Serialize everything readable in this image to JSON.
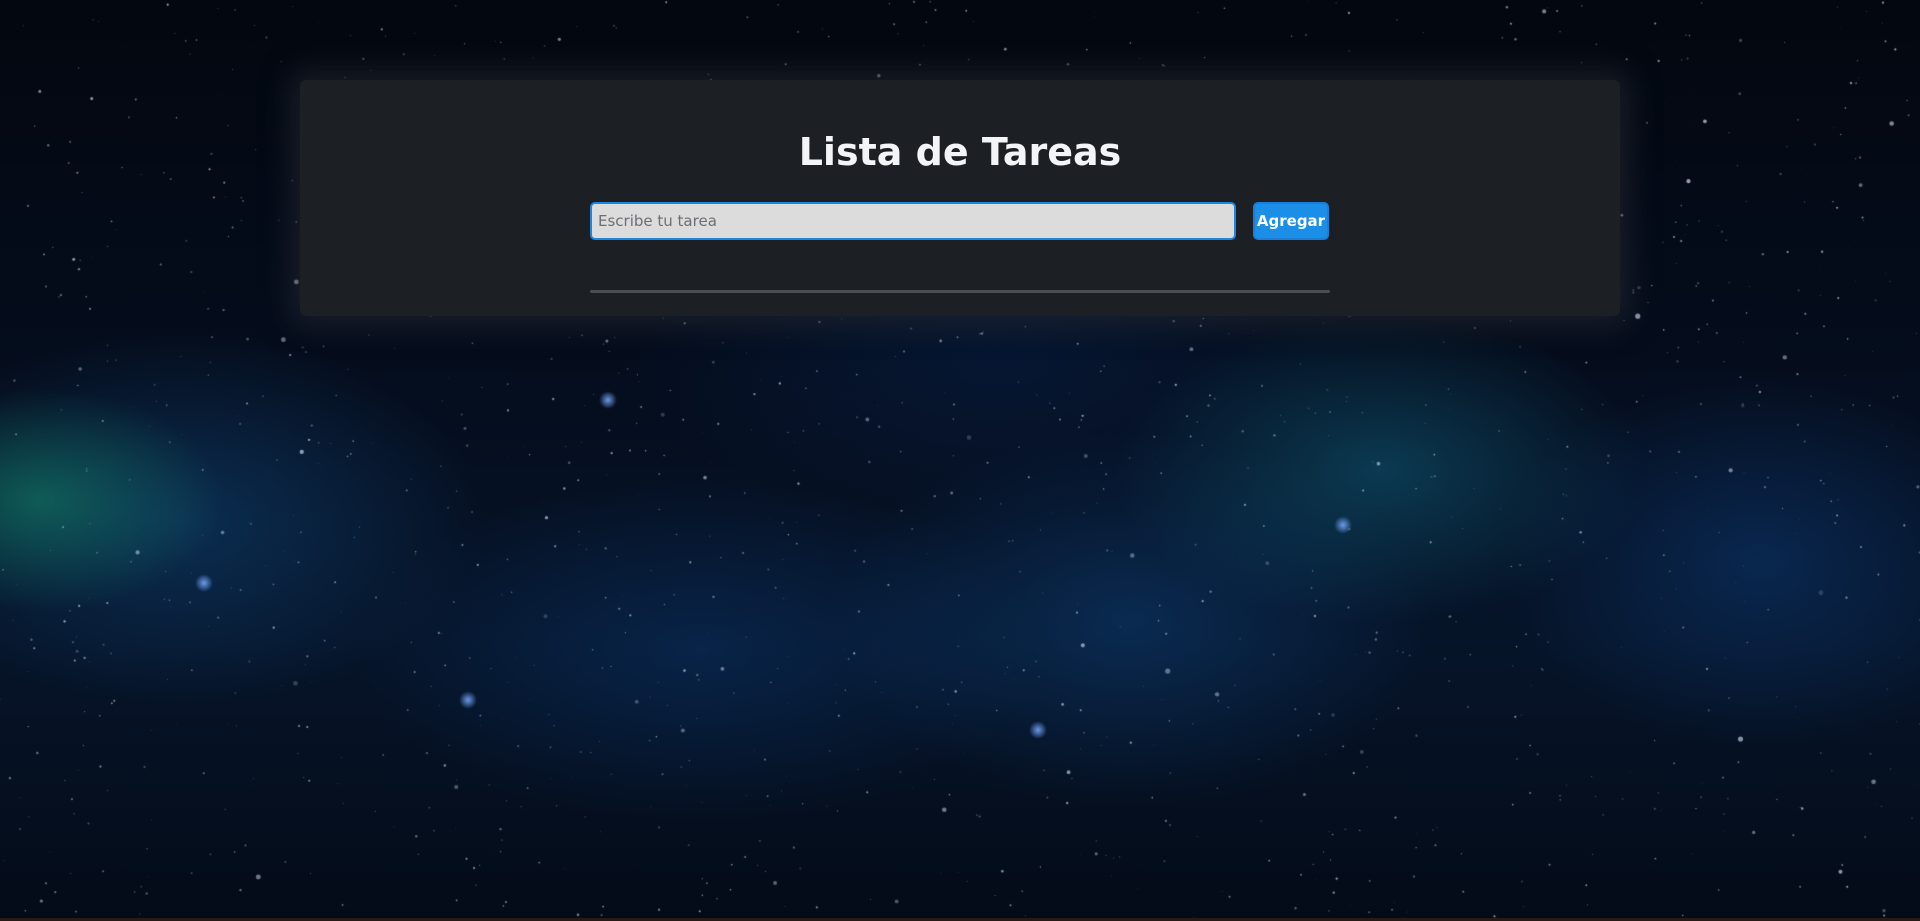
{
  "app": {
    "title": "Lista de Tareas"
  },
  "task_form": {
    "input_value": "",
    "input_placeholder": "Escribe tu tarea",
    "add_button_label": "Agregar"
  },
  "task_list": {
    "items": []
  },
  "colors": {
    "card_background": "#1c1f23",
    "accent_blue": "#1b8fe8",
    "input_background": "#dcdcdc",
    "divider": "#4a4d52",
    "title_text": "#f2f4f7"
  }
}
